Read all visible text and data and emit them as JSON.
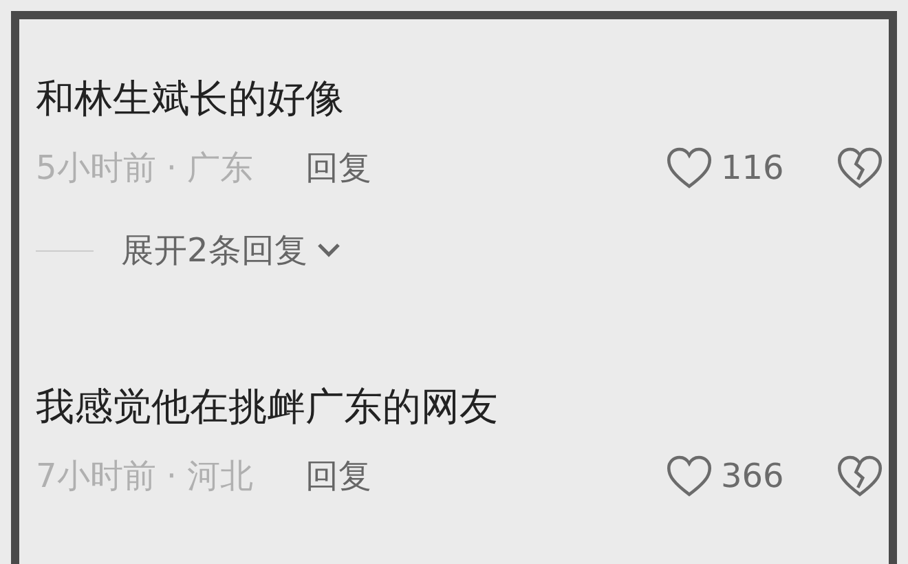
{
  "comments": [
    {
      "text": "和林生斌长的好像",
      "time_location": "5小时前 · 广东",
      "reply": "回复",
      "likes": "116",
      "expand_replies": "展开2条回复"
    },
    {
      "text": "我感觉他在挑衅广东的网友",
      "time_location": "7小时前 · 河北",
      "reply": "回复",
      "likes": "366"
    }
  ]
}
